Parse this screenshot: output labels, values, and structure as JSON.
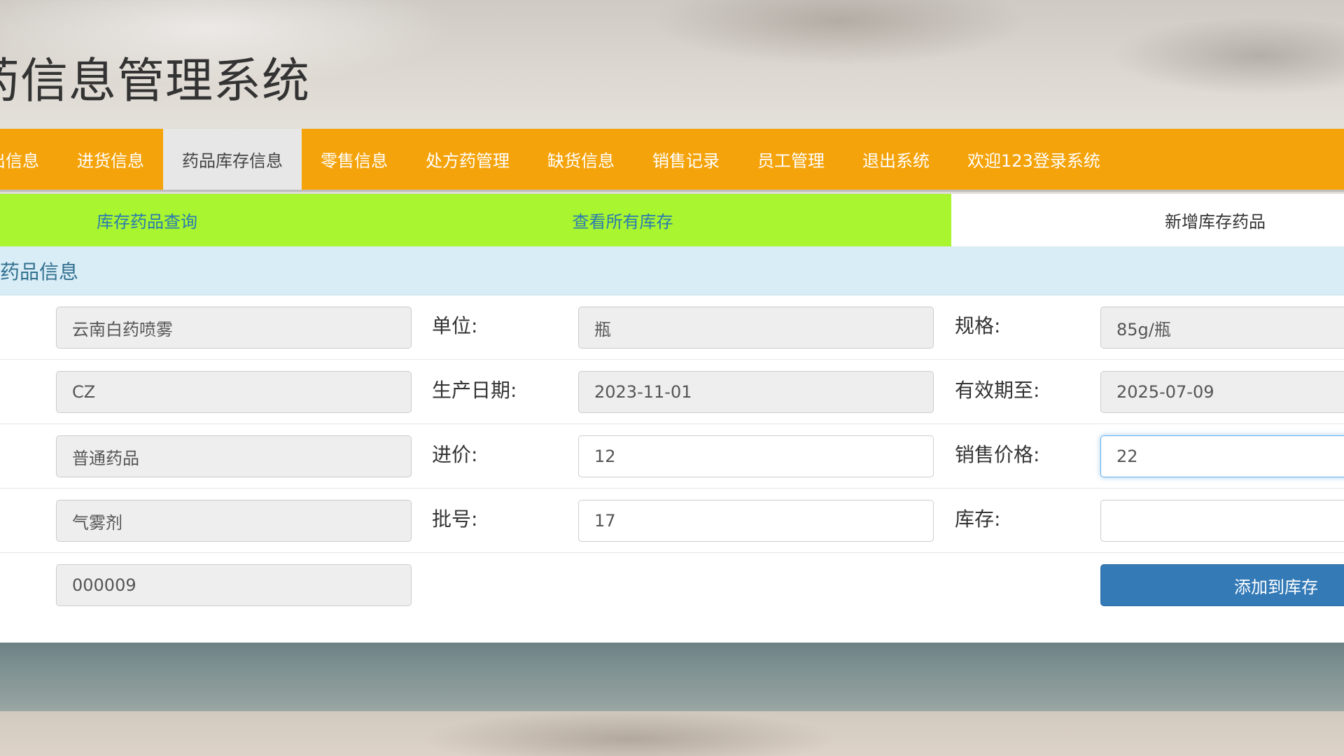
{
  "app": {
    "title": "药信息管理系统"
  },
  "nav": {
    "items": [
      {
        "label": "出信息",
        "active": false
      },
      {
        "label": "进货信息",
        "active": false
      },
      {
        "label": "药品库存信息",
        "active": true
      },
      {
        "label": "零售信息",
        "active": false
      },
      {
        "label": "处方药管理",
        "active": false
      },
      {
        "label": "缺货信息",
        "active": false
      },
      {
        "label": "销售记录",
        "active": false
      },
      {
        "label": "员工管理",
        "active": false
      },
      {
        "label": "退出系统",
        "active": false
      },
      {
        "label": "欢迎123登录系统",
        "active": false
      }
    ],
    "bar_color": "#f5a30a"
  },
  "subtabs": {
    "items": [
      {
        "label": "库存药品查询",
        "active": false
      },
      {
        "label": "查看所有库存",
        "active": false
      },
      {
        "label": "新增库存药品",
        "active": true
      }
    ],
    "color": "#a8f530"
  },
  "panel": {
    "heading": "药品信息"
  },
  "form": {
    "name_value": "云南白药喷雾",
    "unit_label": "单位:",
    "unit_value": "瓶",
    "spec_label": "规格:",
    "spec_value": "85g/瓶",
    "maker_value": "CZ",
    "prod_date_label": "生产日期:",
    "prod_date_value": "2023-11-01",
    "expiry_label": "有效期至:",
    "expiry_value": "2025-07-09",
    "type_value": "普通药品",
    "purchase_price_label": "进价:",
    "purchase_price_value": "12",
    "sale_price_label": "销售价格:",
    "sale_price_value": "22",
    "form_value": "气雾剂",
    "batch_label": "批号:",
    "batch_value": "17",
    "stock_label": "库存:",
    "stock_value": "",
    "code_value": "000009",
    "submit_label": "添加到库存"
  },
  "colors": {
    "primary": "#337ab7",
    "heading_bg": "#d9edf7",
    "heading_text": "#31708f"
  }
}
